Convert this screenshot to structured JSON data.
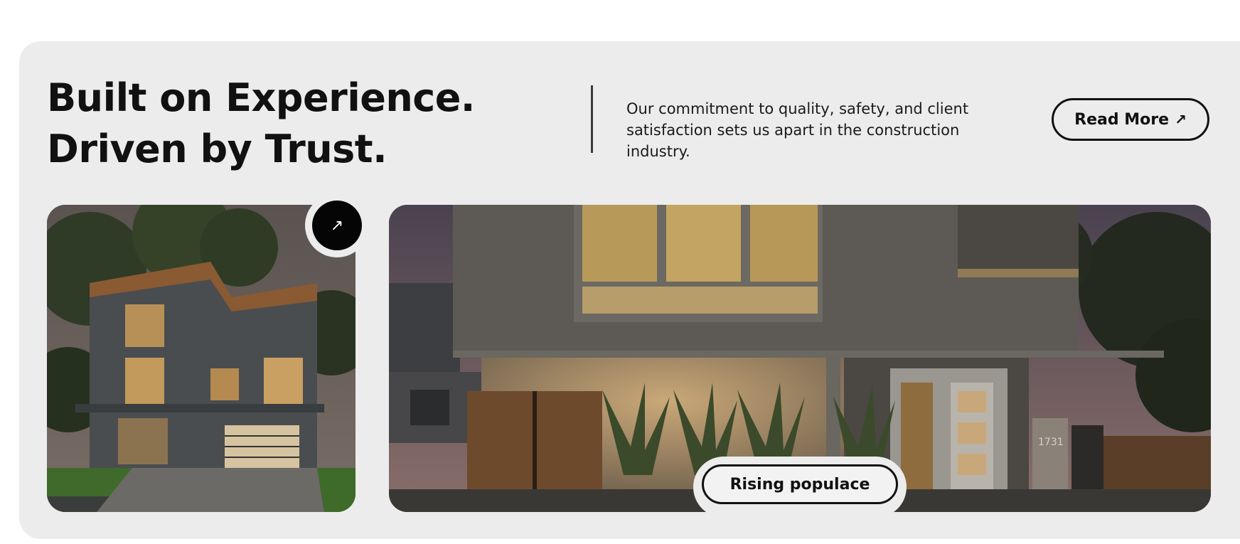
{
  "hero": {
    "headline_line1": "Built on Experience.",
    "headline_line2": "Driven by Trust.",
    "intro_text": "Our commitment to quality, safety, and client satisfaction sets us apart in the construction industry.",
    "read_more_label": "Read More",
    "read_more_icon": "↗",
    "corner_button_icon": "↗"
  },
  "gallery": {
    "featured_label": "Rising populace",
    "house_number": "1731"
  },
  "colors": {
    "panel_background": "#ececec",
    "text": "#111111",
    "button_dark": "#050505"
  }
}
